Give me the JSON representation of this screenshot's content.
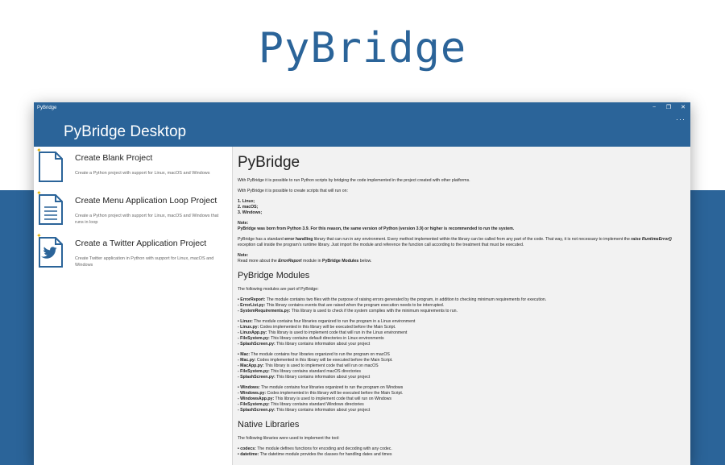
{
  "hero": {
    "title": "PyBridge"
  },
  "window": {
    "title": "PyBridge",
    "controls": {
      "minimize": "−",
      "restore": "❐",
      "close": "✕"
    },
    "app_title": "PyBridge Desktop",
    "more": "···"
  },
  "sidebar": {
    "items": [
      {
        "label": "Create Blank Project",
        "desc": "Create a Python project with support for Linux, macOS and Windows",
        "icon": "document-icon"
      },
      {
        "label": "Create Menu Application Loop Project",
        "desc": "Create a Python project with support for Linux, macOS and Windows that runs in loop",
        "icon": "list-document-icon"
      },
      {
        "label": "Create a Twitter Application Project",
        "desc": "Create Twitter application in Python with support for Linux, macOS and Windows",
        "icon": "twitter-document-icon"
      }
    ]
  },
  "content": {
    "title": "PyBridge",
    "intro1": "With PyBridge it is possible to run Python scripts by bridging the code implemented in the project created with other platforms.",
    "intro2": "With PyBridge it is possible to create scripts that will run on:",
    "os1": "1. Linux;",
    "os2": "2. macOS;",
    "os3": "3. Windows;",
    "note_label": "Note:",
    "note_text": "PyBridge was born from Python 3.9. For this reason, the same version of Python (version 3.9) or higher is recommended to run the system.",
    "err_a": "PyBridge has a standard ",
    "err_b": "error handling",
    "err_c": " library that can run in any environment. Every method implemented within the library can be called from any part of the code. That way, it is not necessary to implement the ",
    "err_d": "raise RuntimeError()",
    "err_e": " exception call inside the program's runtime library. Just import the module and reference the function call according to the treatment that must be executed.",
    "note2_label": "Note:",
    "note2_a": "Read more about the ",
    "note2_b": "ErrorReport",
    "note2_c": " module in ",
    "note2_d": "PyBridge Modules",
    "note2_e": " below.",
    "modules_heading": "PyBridge Modules",
    "modules_intro": "The following modules are part of PyBridge:",
    "modules": [
      [
        [
          "• ErrorReport:",
          " The module contains two files with the purpose of raising errors generated by the program, in addition to checking minimum requirements for execution."
        ],
        [
          "- ErrorList.py:",
          " This library contains events that are raised when the program execution needs to be interrupted."
        ],
        [
          "- SystemRequirements.py:",
          " This library is used to check if the system complies with the minimum requirements to run."
        ]
      ],
      [
        [
          "• Linux:",
          " The module contains four libraries organized to run the program in a Linux environment"
        ],
        [
          "- Linux.py:",
          " Codes implemented in this library will be executed before the Main Script."
        ],
        [
          "- LinuxApp.py:",
          " This library is used to implement code that will run in the Linux environment"
        ],
        [
          "- FileSystem.py:",
          " This library contains default directories in Linux environments"
        ],
        [
          "- SplashScreen.py:",
          " This library contains information about your project"
        ]
      ],
      [
        [
          "• Mac:",
          " The module contains four libraries organized to run the program on macOS"
        ],
        [
          "- Mac.py:",
          " Codes implemented in this library will be executed before the Main Script."
        ],
        [
          "- MacApp.py:",
          " This library is used to implement code that will run on macOS"
        ],
        [
          "- FileSystem.py:",
          " This library contains standard macOS directories"
        ],
        [
          "- SplashScreen.py:",
          " This library contains information about your project"
        ]
      ],
      [
        [
          "• Windows:",
          " The module contains four libraries organized to run the program on Windows"
        ],
        [
          "- Windows.py:",
          " Codes implemented in this library will be executed before the Main Script."
        ],
        [
          "- WindowsApp.py:",
          " This library is used to implement code that will run on Windows"
        ],
        [
          "- FileSystem.py:",
          " This library contains standard Windows directories"
        ],
        [
          "- SplashScreen.py:",
          " This library contains information about your project"
        ]
      ]
    ],
    "native_heading": "Native Libraries",
    "native_intro": "The following libraries were used to implement the tool:",
    "native": [
      [
        "• codecs:",
        " The module defines functions for encoding and decoding with any codec."
      ],
      [
        "• datetime:",
        " The datetime module provides the classes for handling dates and times"
      ]
    ]
  }
}
